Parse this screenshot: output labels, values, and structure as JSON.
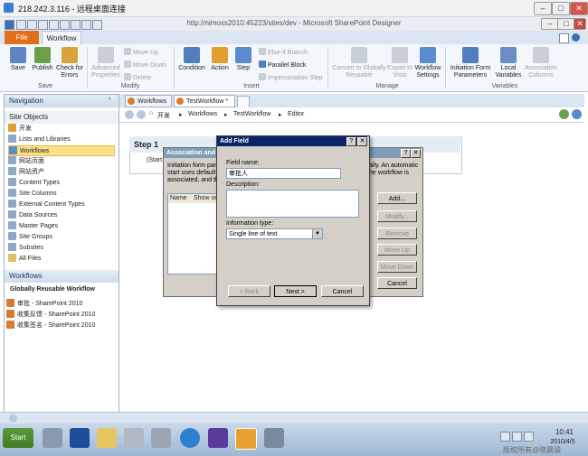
{
  "rdp": {
    "title": "218.242.3.116 - 远程桌面连接"
  },
  "app": {
    "title": "http://nimoss2010:45223/sites/dev - Microsoft SharePoint Designer"
  },
  "ribbon": {
    "tabs": [
      "File",
      "Workflow"
    ],
    "buttons": {
      "save": "Save",
      "publish": "Publish",
      "check": "Check for Errors",
      "adv": "Advanced Properties",
      "move_up": "Move Up",
      "move_down": "Move Down",
      "delete": "Delete",
      "condition": "Condition",
      "action": "Action",
      "step": "Step",
      "elseif": "Else-If Branch",
      "parallel": "Parallel Block",
      "impersonation": "Impersonation Step",
      "convert": "Convert to Globally Reusable",
      "export": "Export to Visio",
      "wf_settings": "Workflow Settings",
      "init_params": "Initiation Form Parameters",
      "local_vars": "Local Variables",
      "assoc_cols": "Association Columns"
    },
    "groups": {
      "save": "Save",
      "modify": "Modify",
      "insert": "Insert",
      "manage": "Manage",
      "variables": "Variables"
    }
  },
  "nav": {
    "header": "Navigation",
    "site_objects": "Site Objects",
    "items": [
      "开发",
      "Lists and Libraries",
      "Workflows",
      "网站页面",
      "网站资产",
      "Content Types",
      "Site Columns",
      "External Content Types",
      "Data Sources",
      "Master Pages",
      "Site Groups",
      "Subsites",
      "All Files"
    ],
    "workflows_header": "Workflows",
    "reusable_header": "Globally Reusable Workflow",
    "workflows": [
      "审批 - SharePoint 2010",
      "收集反馈 - SharePoint 2010",
      "收集签名 - SharePoint 2010"
    ]
  },
  "doc_tabs": [
    "Workflows",
    "TestWorkflow *"
  ],
  "breadcrumb": [
    "开发",
    "Workflows",
    "TestWorkflow",
    "Editor"
  ],
  "editor": {
    "step_title": "Step 1",
    "step_text": "(Start"
  },
  "assoc_dialog": {
    "title": "Association and",
    "intro": "Initiation form par",
    "intro2": "start uses default",
    "intro3": "associated, and th",
    "intro_right": "ally. An automatic",
    "intro_right2": "he workflow is",
    "col_name": "Name",
    "col_show": "Show on",
    "buttons": {
      "add": "Add...",
      "modify": "Modify...",
      "remove": "Remove",
      "move_up": "Move Up",
      "move_down": "Move Down",
      "cancel": "Cancel"
    }
  },
  "add_field": {
    "title": "Add Field",
    "field_name_label": "Field name:",
    "field_name_value": "审批人",
    "description_label": "Description:",
    "info_type_label": "Information type:",
    "info_type_value": "Single line of text",
    "back": "< Back",
    "next": "Next >",
    "cancel": "Cancel"
  },
  "taskbar": {
    "start": "Start",
    "time": "10:41",
    "date": "2010/4/5",
    "watermark": "版权所有@晓晨骏"
  }
}
